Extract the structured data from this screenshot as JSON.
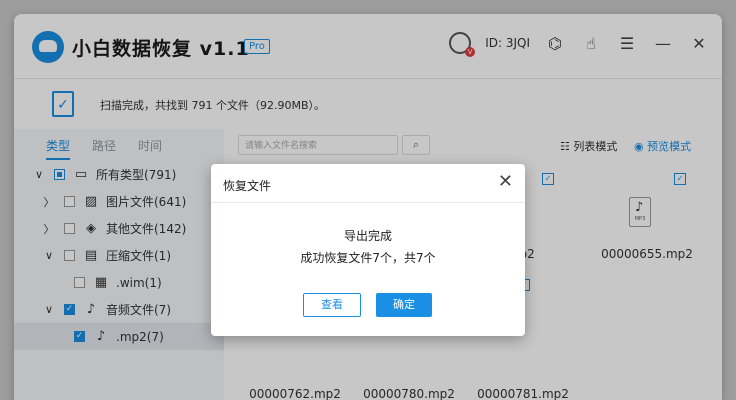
{
  "app": {
    "title": "小白数据恢复 v1.1",
    "badge": "Pro"
  },
  "header": {
    "user_id": "ID: 3JQI",
    "avatar_badge": "V",
    "minimize": "—",
    "menu": "☰",
    "close": "✕"
  },
  "status": {
    "text": "扫描完成，共找到 791 个文件（92.90MB）。"
  },
  "sidebar": {
    "tabs": [
      "类型",
      "路径",
      "时间"
    ],
    "tree": [
      {
        "label": "所有类型(791)",
        "arrow": "∨",
        "check": "partial",
        "icon": "▭"
      },
      {
        "label": "图片文件(641)",
        "arrow": "〉",
        "check": "off",
        "icon": "▨"
      },
      {
        "label": "其他文件(142)",
        "arrow": "〉",
        "check": "off",
        "icon": "◈"
      },
      {
        "label": "压缩文件(1)",
        "arrow": "∨",
        "check": "off",
        "icon": "▤"
      },
      {
        "label": ".wim(1)",
        "arrow": "",
        "check": "off",
        "icon": "▦"
      },
      {
        "label": "音频文件(7)",
        "arrow": "∨",
        "check": "on",
        "icon": "♪"
      },
      {
        "label": ".mp2(7)",
        "arrow": "",
        "check": "on",
        "icon": "♪"
      }
    ]
  },
  "main": {
    "search_placeholder": "请输入文件名搜索",
    "view_list": "☷ 列表模式",
    "view_grid": "◉ 预览模式",
    "files": [
      {
        "name": ".mp2"
      },
      {
        "name": "00000655.mp2"
      },
      {
        "name": "00000762.mp2"
      },
      {
        "name": "00000780.mp2"
      },
      {
        "name": "00000781.mp2"
      }
    ],
    "file_icon_label": "MP3"
  },
  "dialog": {
    "title": "恢复文件",
    "message1": "导出完成",
    "message2": "成功恢复文件7个，共7个",
    "view_button": "查看",
    "ok_button": "确定",
    "close": "✕"
  },
  "colors": {
    "accent": "#1a8fe3",
    "window_bg": "#f4f6f8",
    "overlay": "rgba(0,0,0,0.22)"
  }
}
